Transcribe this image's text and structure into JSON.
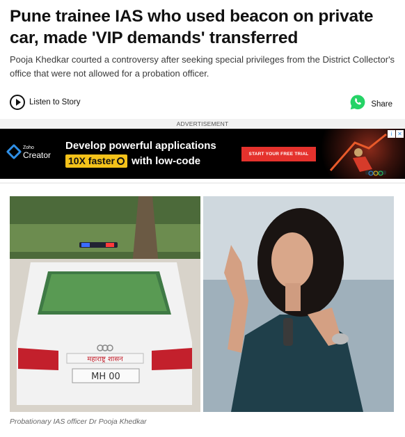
{
  "article": {
    "headline": "Pune trainee IAS who used beacon on private car, made 'VIP demands' transferred",
    "summary": "Pooja Khedkar courted a controversy after seeking special privileges from the District Collector's office that were not allowed for a probation officer."
  },
  "actions": {
    "listen_label": "Listen to Story",
    "share_label": "Share"
  },
  "advertisement": {
    "label": "ADVERTISEMENT",
    "brand_small": "Zoho",
    "brand_big": "Creator",
    "headline": "Develop powerful applications",
    "badge": "10X faster",
    "tail": "with low-code",
    "cta": "START YOUR FREE TRIAL"
  },
  "image": {
    "left_plate_text": "महाराष्ट्र शासन",
    "left_number_text": "MH 00",
    "caption": "Probationary IAS officer Dr Pooja Khedkar"
  },
  "colors": {
    "whatsapp": "#25d366",
    "ad_cta": "#e5322d",
    "ad_badge": "#f4c21a"
  }
}
